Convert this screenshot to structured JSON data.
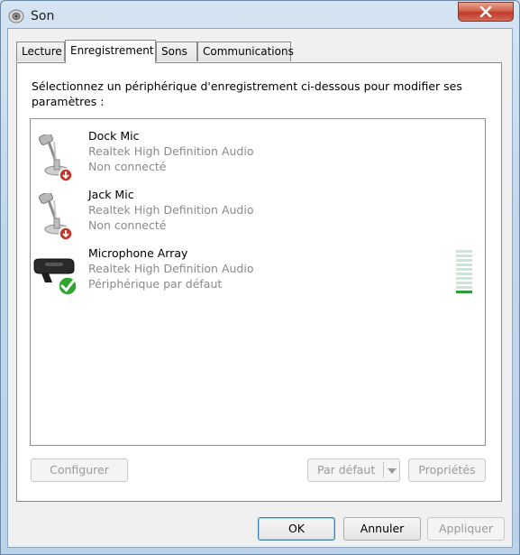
{
  "window": {
    "title": "Son"
  },
  "tabs": [
    {
      "label": "Lecture",
      "active": false
    },
    {
      "label": "Enregistrement",
      "active": true
    },
    {
      "label": "Sons",
      "active": false
    },
    {
      "label": "Communications",
      "active": false
    }
  ],
  "instruction": "Sélectionnez un périphérique d'enregistrement ci-dessous pour modifier ses paramètres :",
  "devices": [
    {
      "name": "Dock Mic",
      "driver": "Realtek High Definition Audio",
      "status": "Non connecté",
      "icon": "microphone-icon",
      "badge": "disconnected-badge-icon"
    },
    {
      "name": "Jack Mic",
      "driver": "Realtek High Definition Audio",
      "status": "Non connecté",
      "icon": "microphone-icon",
      "badge": "disconnected-badge-icon"
    },
    {
      "name": "Microphone Array",
      "driver": "Realtek High Definition Audio",
      "status": "Périphérique par défaut",
      "icon": "microphone-array-icon",
      "badge": "default-check-icon",
      "level": 0.1
    }
  ],
  "buttons": {
    "configure": "Configurer",
    "set_default": "Par défaut",
    "properties": "Propriétés",
    "ok": "OK",
    "cancel": "Annuler",
    "apply": "Appliquer"
  },
  "colors": {
    "badge_red": "#c0392b",
    "badge_green": "#2fa52f",
    "level_green": "#2a9d3a"
  }
}
